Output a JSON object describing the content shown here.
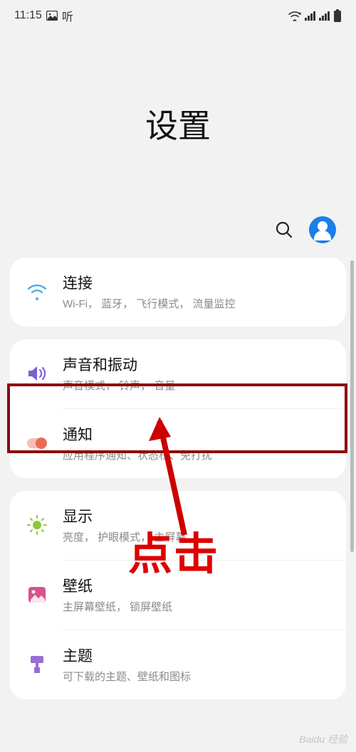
{
  "statusBar": {
    "time": "11:15",
    "app": "听"
  },
  "header": {
    "title": "设置"
  },
  "cards": [
    {
      "items": [
        {
          "title": "连接",
          "subtitle": "Wi-Fi， 蓝牙， 飞行模式， 流量监控"
        }
      ]
    },
    {
      "items": [
        {
          "title": "声音和振动",
          "subtitle": "声音模式， 铃声， 音量"
        },
        {
          "title": "通知",
          "subtitle": "应用程序通知、状态栏、免打扰"
        }
      ]
    },
    {
      "items": [
        {
          "title": "显示",
          "subtitle": "亮度， 护眼模式， 主屏幕"
        },
        {
          "title": "壁纸",
          "subtitle": "主屏幕壁纸， 锁屏壁纸"
        },
        {
          "title": "主题",
          "subtitle": "可下载的主题、壁纸和图标"
        }
      ]
    }
  ],
  "annotation": {
    "label": "点击"
  },
  "watermark": "Baidu 经验"
}
